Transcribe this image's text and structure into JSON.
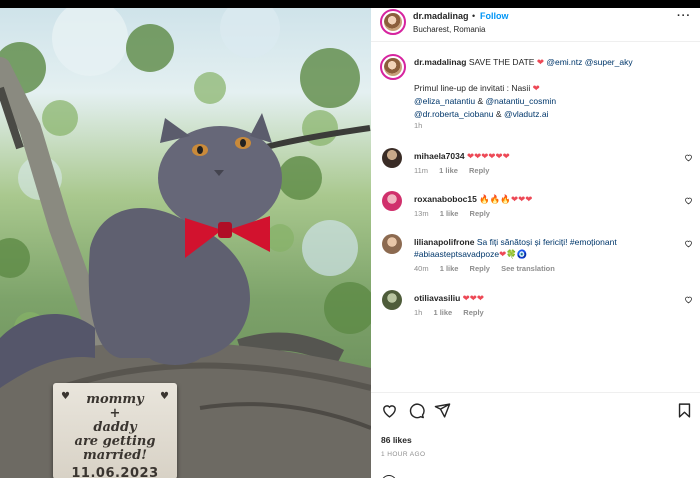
{
  "header": {
    "username": "dr.madalinag",
    "separator": "•",
    "follow_label": "Follow",
    "location": "Bucharest, Romania",
    "more_label": "···"
  },
  "photo": {
    "sign_line1": "mommy",
    "sign_line2": "+",
    "sign_line3": "daddy",
    "sign_line4": "are getting",
    "sign_line5": "married!",
    "sign_date": "11.06.2023"
  },
  "caption": {
    "username": "dr.madalinag",
    "text1": "SAVE THE DATE",
    "mention1": "@emi.ntz",
    "mention2": "@super_aky",
    "line2": "Primul line-up de invitati : Nasii",
    "m3": "@eliza_natantiu",
    "amp1": "&",
    "m4": "@natantiu_cosmin",
    "m5": "@dr.roberta_ciobanu",
    "amp2": "&",
    "m6": "@vladutz.ai",
    "time": "1h"
  },
  "comments": [
    {
      "username": "mihaela7034",
      "text": "❤❤❤❤❤❤",
      "time": "11m",
      "likes": "1 like",
      "reply": "Reply"
    },
    {
      "username": "roxanaboboc15",
      "text": "🔥🔥🔥❤❤❤",
      "time": "13m",
      "likes": "1 like",
      "reply": "Reply"
    },
    {
      "username": "lilianapolifrone",
      "text": "Sa fiți sănătoși și fericiți!",
      "hashtag1": "#emoționant",
      "hashtag2": "#abiaasteptsavadpoze",
      "emoji": "❤🍀🧿",
      "time": "40m",
      "likes": "1 like",
      "reply": "Reply",
      "translate": "See translation"
    },
    {
      "username": "otiliavasiliu",
      "text": "❤❤❤",
      "time": "1h",
      "likes": "1 like",
      "reply": "Reply"
    }
  ],
  "footer": {
    "likes": "86 likes",
    "ago": "1 HOUR AGO"
  },
  "colors": {
    "follow": "#0095f6",
    "mention": "#00376b",
    "heart": "#ed4956",
    "muted": "#8e8e8e"
  },
  "icons": [
    "more-options-icon",
    "comment-like-heart-icon",
    "like-heart-icon",
    "comment-bubble-icon",
    "share-paper-plane-icon",
    "save-bookmark-icon",
    "emoji-icon"
  ]
}
